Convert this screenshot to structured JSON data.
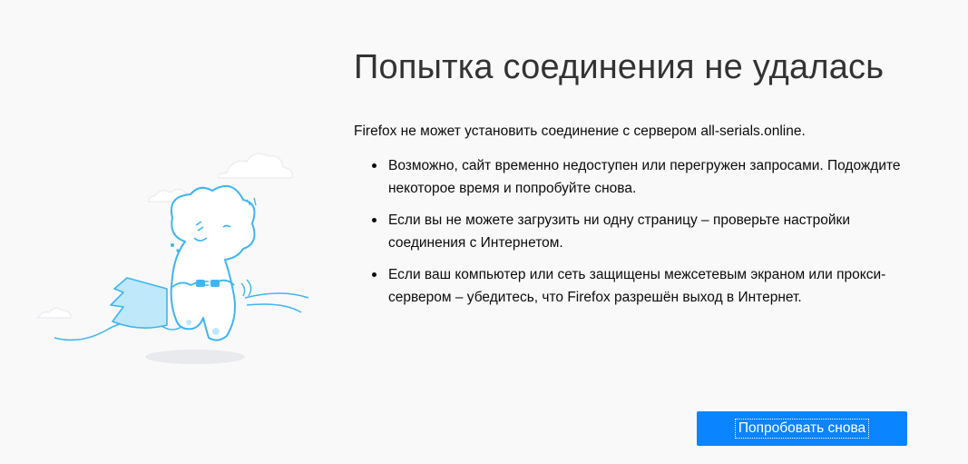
{
  "error_page": {
    "title": "Попытка соединения не удалась",
    "intro": "Firefox не может установить соединение с сервером all-serials.online.",
    "reasons": [
      "Возможно, сайт временно недоступен или перегружен запросами. Подождите некоторое время и попробуйте снова.",
      "Если вы не можете загрузить ни одну страницу – проверьте настройки соединения с Интернетом.",
      "Если ваш компьютер или сеть защищены межсетевым экраном или прокси-сервером – убедитесь, что Firefox разрешён выход в Интернет."
    ],
    "retry_button": "Попробовать снова"
  },
  "colors": {
    "background": "#f9f9fa",
    "accent": "#0a84ff",
    "illustration_stroke": "#3fb5f2",
    "illustration_fill": "#e4f5fd"
  },
  "icons": {
    "illustration": "disconnected-dinosaur-illustration"
  }
}
